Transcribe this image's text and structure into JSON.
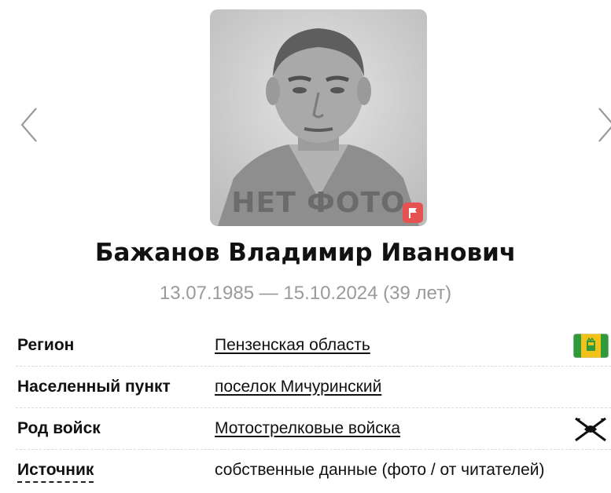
{
  "photo": {
    "placeholder_text": "НЕТ ФОТО",
    "flag_icon": "report-flag-icon"
  },
  "nav": {
    "prev_icon": "chevron-left-icon",
    "next_icon": "chevron-right-icon"
  },
  "person": {
    "name": "Бажанов Владимир Иванович",
    "dates": "13.07.1985 — 15.10.2024 (39 лет)"
  },
  "details": [
    {
      "label": "Регион",
      "value": "Пензенская область",
      "icon": "penza-region-flag-icon"
    },
    {
      "label": "Населенный пункт",
      "value": "поселок Мичуринский"
    },
    {
      "label": "Род войск",
      "value": "Мотострелковые войска",
      "icon": "motor-rifle-troops-icon"
    },
    {
      "label": "Источник",
      "value": "собственные данные (фото / от читателей)"
    }
  ],
  "colors": {
    "accent_red": "#e6524f",
    "muted_text": "#9a9a9a",
    "flag_green": "#2e9a3a",
    "flag_yellow": "#f2c21b"
  }
}
